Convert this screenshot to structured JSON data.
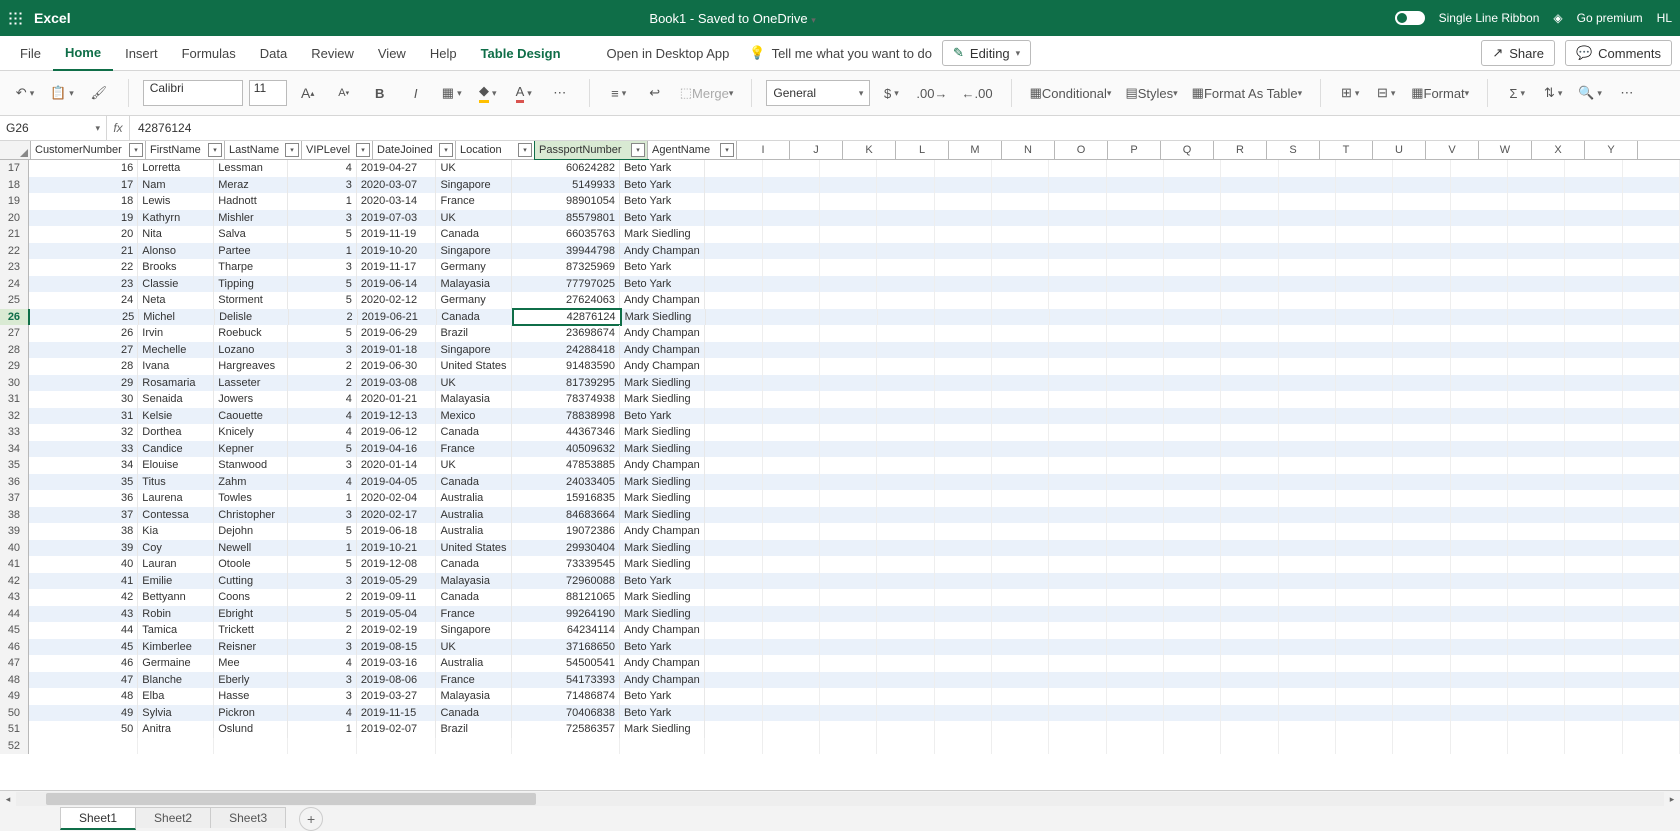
{
  "titlebar": {
    "app_name": "Excel",
    "doc_title": "Book1 - Saved to OneDrive",
    "single_line": "Single Line Ribbon",
    "premium": "Go premium",
    "user": "HL"
  },
  "tabs": {
    "file": "File",
    "home": "Home",
    "insert": "Insert",
    "formulas": "Formulas",
    "data": "Data",
    "review": "Review",
    "view": "View",
    "help": "Help",
    "design": "Table Design",
    "desktop": "Open in Desktop App",
    "tell_me": "Tell me what you want to do",
    "editing": "Editing",
    "share": "Share",
    "comments": "Comments"
  },
  "ribbon": {
    "font": "Calibri",
    "size": "11",
    "merge": "Merge",
    "number_format": "General",
    "conditional": "Conditional",
    "styles": "Styles",
    "table": "Format As Table",
    "format": "Format"
  },
  "formula": {
    "name_box": "G26",
    "fx": "fx",
    "value": "42876124"
  },
  "columns": {
    "table": [
      "CustomerNumber",
      "FirstName",
      "LastName",
      "VIPLevel",
      "DateJoined",
      "Location",
      "PassportNumber",
      "AgentName"
    ],
    "extra": [
      "I",
      "J",
      "K",
      "L",
      "M",
      "N",
      "O",
      "P",
      "Q",
      "R",
      "S",
      "T",
      "U",
      "V",
      "W",
      "X",
      "Y"
    ]
  },
  "selected_header": "PassportNumber",
  "active_row": 26,
  "active_cell_col": 6,
  "first_row_num": 17,
  "last_empty_row": 52,
  "chart_data": {
    "type": "table",
    "columns": [
      "CustomerNumber",
      "FirstName",
      "LastName",
      "VIPLevel",
      "DateJoined",
      "Location",
      "PassportNumber",
      "AgentName"
    ],
    "rows": [
      [
        16,
        "Lorretta",
        "Lessman",
        4,
        "2019-04-27",
        "UK",
        60624282,
        "Beto Yark"
      ],
      [
        17,
        "Nam",
        "Meraz",
        3,
        "2020-03-07",
        "Singapore",
        5149933,
        "Beto Yark"
      ],
      [
        18,
        "Lewis",
        "Hadnott",
        1,
        "2020-03-14",
        "France",
        98901054,
        "Beto Yark"
      ],
      [
        19,
        "Kathyrn",
        "Mishler",
        3,
        "2019-07-03",
        "UK",
        85579801,
        "Beto Yark"
      ],
      [
        20,
        "Nita",
        "Salva",
        5,
        "2019-11-19",
        "Canada",
        66035763,
        "Mark Siedling"
      ],
      [
        21,
        "Alonso",
        "Partee",
        1,
        "2019-10-20",
        "Singapore",
        39944798,
        "Andy Champan"
      ],
      [
        22,
        "Brooks",
        "Tharpe",
        3,
        "2019-11-17",
        "Germany",
        87325969,
        "Beto Yark"
      ],
      [
        23,
        "Classie",
        "Tipping",
        5,
        "2019-06-14",
        "Malayasia",
        77797025,
        "Beto Yark"
      ],
      [
        24,
        "Neta",
        "Storment",
        5,
        "2020-02-12",
        "Germany",
        27624063,
        "Andy Champan"
      ],
      [
        25,
        "Michel",
        "Delisle",
        2,
        "2019-06-21",
        "Canada",
        42876124,
        "Mark Siedling"
      ],
      [
        26,
        "Irvin",
        "Roebuck",
        5,
        "2019-06-29",
        "Brazil",
        23698674,
        "Andy Champan"
      ],
      [
        27,
        "Mechelle",
        "Lozano",
        3,
        "2019-01-18",
        "Singapore",
        24288418,
        "Andy Champan"
      ],
      [
        28,
        "Ivana",
        "Hargreaves",
        2,
        "2019-06-30",
        "United States",
        91483590,
        "Andy Champan"
      ],
      [
        29,
        "Rosamaria",
        "Lasseter",
        2,
        "2019-03-08",
        "UK",
        81739295,
        "Mark Siedling"
      ],
      [
        30,
        "Senaida",
        "Jowers",
        4,
        "2020-01-21",
        "Malayasia",
        78374938,
        "Mark Siedling"
      ],
      [
        31,
        "Kelsie",
        "Caouette",
        4,
        "2019-12-13",
        "Mexico",
        78838998,
        "Beto Yark"
      ],
      [
        32,
        "Dorthea",
        "Knicely",
        4,
        "2019-06-12",
        "Canada",
        44367346,
        "Mark Siedling"
      ],
      [
        33,
        "Candice",
        "Kepner",
        5,
        "2019-04-16",
        "France",
        40509632,
        "Mark Siedling"
      ],
      [
        34,
        "Elouise",
        "Stanwood",
        3,
        "2020-01-14",
        "UK",
        47853885,
        "Andy Champan"
      ],
      [
        35,
        "Titus",
        "Zahm",
        4,
        "2019-04-05",
        "Canada",
        24033405,
        "Mark Siedling"
      ],
      [
        36,
        "Laurena",
        "Towles",
        1,
        "2020-02-04",
        "Australia",
        15916835,
        "Mark Siedling"
      ],
      [
        37,
        "Contessa",
        "Christopher",
        3,
        "2020-02-17",
        "Australia",
        84683664,
        "Mark Siedling"
      ],
      [
        38,
        "Kia",
        "Dejohn",
        5,
        "2019-06-18",
        "Australia",
        19072386,
        "Andy Champan"
      ],
      [
        39,
        "Coy",
        "Newell",
        1,
        "2019-10-21",
        "United States",
        29930404,
        "Mark Siedling"
      ],
      [
        40,
        "Lauran",
        "Otoole",
        5,
        "2019-12-08",
        "Canada",
        73339545,
        "Mark Siedling"
      ],
      [
        41,
        "Emilie",
        "Cutting",
        3,
        "2019-05-29",
        "Malayasia",
        72960088,
        "Beto Yark"
      ],
      [
        42,
        "Bettyann",
        "Coons",
        2,
        "2019-09-11",
        "Canada",
        88121065,
        "Mark Siedling"
      ],
      [
        43,
        "Robin",
        "Ebright",
        5,
        "2019-05-04",
        "France",
        99264190,
        "Mark Siedling"
      ],
      [
        44,
        "Tamica",
        "Trickett",
        2,
        "2019-02-19",
        "Singapore",
        64234114,
        "Andy Champan"
      ],
      [
        45,
        "Kimberlee",
        "Reisner",
        3,
        "2019-08-15",
        "UK",
        37168650,
        "Beto Yark"
      ],
      [
        46,
        "Germaine",
        "Mee",
        4,
        "2019-03-16",
        "Australia",
        54500541,
        "Andy Champan"
      ],
      [
        47,
        "Blanche",
        "Eberly",
        3,
        "2019-08-06",
        "France",
        54173393,
        "Andy Champan"
      ],
      [
        48,
        "Elba",
        "Hasse",
        3,
        "2019-03-27",
        "Malayasia",
        71486874,
        "Beto Yark"
      ],
      [
        49,
        "Sylvia",
        "Pickron",
        4,
        "2019-11-15",
        "Canada",
        70406838,
        "Beto Yark"
      ],
      [
        50,
        "Anitra",
        "Oslund",
        1,
        "2019-02-07",
        "Brazil",
        72586357,
        "Mark Siedling"
      ]
    ]
  },
  "sheets": {
    "s1": "Sheet1",
    "s2": "Sheet2",
    "s3": "Sheet3"
  }
}
